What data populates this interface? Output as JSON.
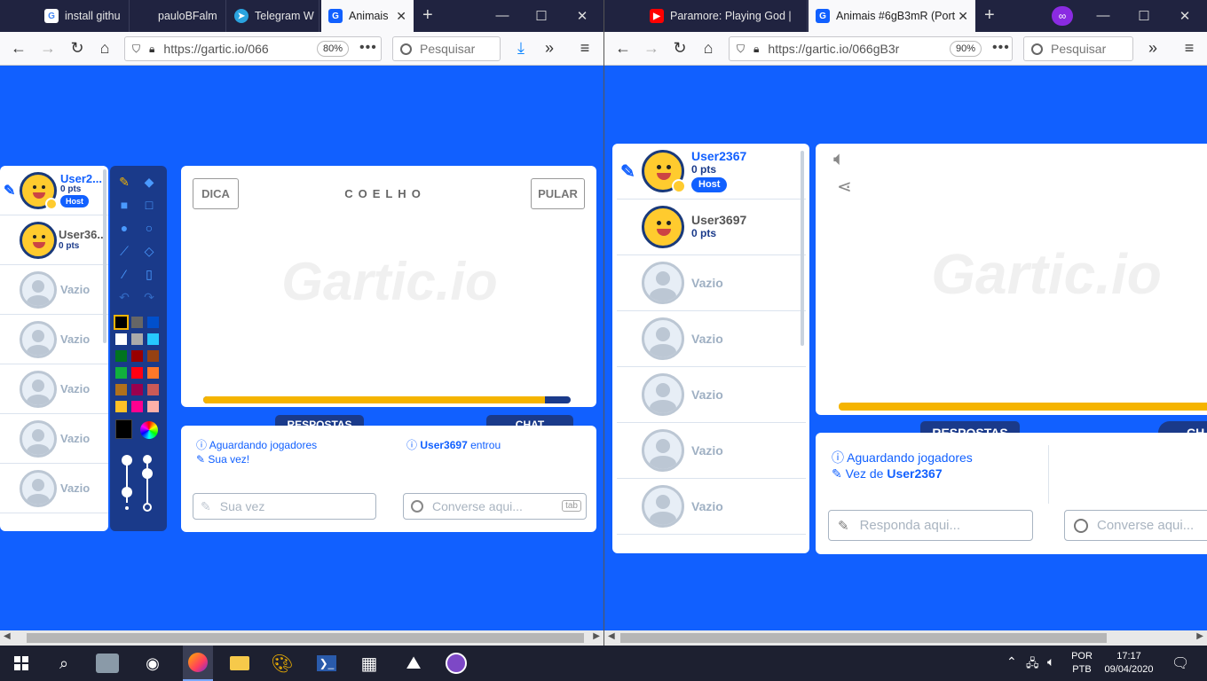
{
  "left_window": {
    "tabs": [
      {
        "label": "install githu",
        "icon": "google-icon"
      },
      {
        "label": "pauloBFalm",
        "icon": "github-icon"
      },
      {
        "label": "Telegram W",
        "icon": "telegram-icon"
      },
      {
        "label": "Animais",
        "icon": "gartic-icon",
        "active": true
      }
    ],
    "url": "https://gartic.io/066",
    "zoom": "80%",
    "search_placeholder": "Pesquisar"
  },
  "right_window": {
    "tabs": [
      {
        "label": "Paramore: Playing God |",
        "icon": "youtube-icon"
      },
      {
        "label": "Animais #6gB3mR (Port",
        "icon": "gartic-icon",
        "active": true
      }
    ],
    "url": "https://gartic.io/066gB3r",
    "zoom": "90%",
    "search_placeholder": "Pesquisar"
  },
  "game_left": {
    "players": [
      {
        "name": "User2...",
        "points": "0 pts",
        "host": "Host",
        "type": "duck"
      },
      {
        "name": "User36...",
        "points": "0 pts",
        "type": "duck"
      },
      {
        "name": "Vazio",
        "type": "empty"
      },
      {
        "name": "Vazio",
        "type": "empty"
      },
      {
        "name": "Vazio",
        "type": "empty"
      },
      {
        "name": "Vazio",
        "type": "empty"
      },
      {
        "name": "Vazio",
        "type": "empty"
      }
    ],
    "hint_button": "DICA",
    "word": "COELHO",
    "skip_button": "PULAR",
    "watermark": "Gartic.io",
    "timer_progress": 0.93,
    "answers_header": "RESPOSTAS",
    "chat_header": "CHAT",
    "answers_messages": [
      {
        "icon": "info-icon",
        "text": "Aguardando jogadores"
      },
      {
        "icon": "pencil-icon",
        "text": "Sua vez!"
      }
    ],
    "chat_messages": [
      {
        "icon": "info-icon",
        "user": "User3697",
        "text": "entrou"
      }
    ],
    "answer_input_placeholder": "Sua vez",
    "chat_input_placeholder": "Converse aqui...",
    "chat_input_key": "tab"
  },
  "game_right": {
    "players": [
      {
        "name": "User2367",
        "points": "0 pts",
        "host": "Host",
        "type": "duck"
      },
      {
        "name": "User3697",
        "points": "0 pts",
        "type": "duck"
      },
      {
        "name": "Vazio",
        "type": "empty"
      },
      {
        "name": "Vazio",
        "type": "empty"
      },
      {
        "name": "Vazio",
        "type": "empty"
      },
      {
        "name": "Vazio",
        "type": "empty"
      },
      {
        "name": "Vazio",
        "type": "empty"
      }
    ],
    "watermark": "Gartic.io",
    "answers_header": "RESPOSTAS",
    "chat_header": "CH",
    "answers_messages": [
      {
        "icon": "info-icon",
        "text": "Aguardando jogadores"
      },
      {
        "icon": "pencil-icon",
        "prefix": "Vez de",
        "user": "User2367"
      }
    ],
    "answer_input_placeholder": "Responda aqui...",
    "chat_input_placeholder": "Converse aqui..."
  },
  "palette": [
    "#000000",
    "#666666",
    "#0050cd",
    "#ffffff",
    "#aaaaaa",
    "#26c9ff",
    "#017420",
    "#990000",
    "#964112",
    "#11b03c",
    "#ff0013",
    "#ff7829",
    "#b0701c",
    "#99004e",
    "#cb5a57",
    "#ffc126",
    "#ff008f",
    "#feafa8"
  ],
  "taskbar": {
    "language": "POR",
    "layout": "PTB",
    "time": "17:17",
    "date": "09/04/2020"
  },
  "colors": {
    "brand_blue": "#1160ff",
    "navy": "#1a3a8a",
    "gold": "#f5b400"
  }
}
